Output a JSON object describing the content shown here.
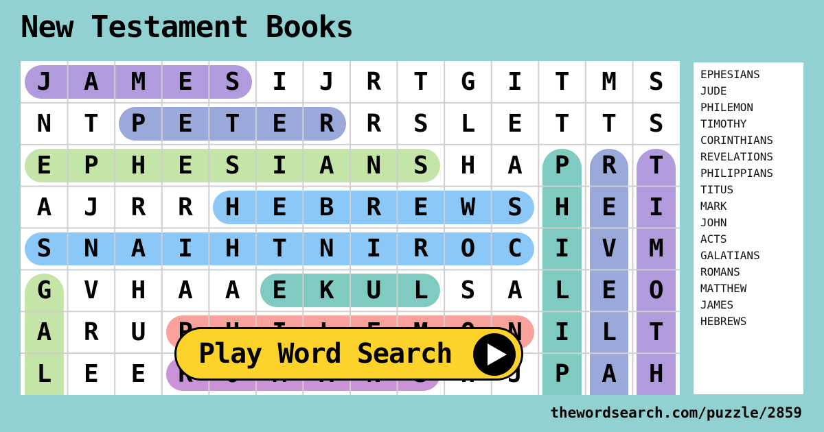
{
  "title": "New Testament Books",
  "grid": {
    "rows": [
      [
        "J",
        "A",
        "M",
        "E",
        "S",
        "I",
        "J",
        "R",
        "T",
        "G",
        "I",
        "T",
        "M",
        "S"
      ],
      [
        "N",
        "T",
        "P",
        "E",
        "T",
        "E",
        "R",
        "R",
        "S",
        "L",
        "E",
        "T",
        "T",
        "S"
      ],
      [
        "E",
        "P",
        "H",
        "E",
        "S",
        "I",
        "A",
        "N",
        "S",
        "H",
        "A",
        "P",
        "R",
        "T"
      ],
      [
        "A",
        "J",
        "R",
        "R",
        "H",
        "E",
        "B",
        "R",
        "E",
        "W",
        "S",
        "H",
        "E",
        "I"
      ],
      [
        "S",
        "N",
        "A",
        "I",
        "H",
        "T",
        "N",
        "I",
        "R",
        "O",
        "C",
        "I",
        "V",
        "M"
      ],
      [
        "G",
        "V",
        "H",
        "A",
        "A",
        "E",
        "K",
        "U",
        "L",
        "S",
        "A",
        "L",
        "E",
        "O"
      ],
      [
        "A",
        "R",
        "U",
        "P",
        "H",
        "I",
        "L",
        "E",
        "M",
        "O",
        "N",
        "I",
        "L",
        "T"
      ],
      [
        "L",
        "E",
        "E",
        "R",
        "O",
        "M",
        "A",
        "N",
        "S",
        "H",
        "J",
        "P",
        "A",
        "H"
      ]
    ],
    "found_words": [
      {
        "word": "JAMES",
        "row": 0,
        "col": 0,
        "dir": "right",
        "length": 5,
        "color": "#9b7fd4"
      },
      {
        "word": "PETER",
        "row": 1,
        "col": 2,
        "dir": "right",
        "length": 5,
        "color": "#7f8fd0"
      },
      {
        "word": "EPHESIANS",
        "row": 2,
        "col": 0,
        "dir": "right",
        "length": 9,
        "color": "#b5dc8f"
      },
      {
        "word": "HEBREWS",
        "row": 3,
        "col": 4,
        "dir": "right",
        "length": 7,
        "color": "#6cb8f5"
      },
      {
        "word": "CORINTHIANS",
        "row": 4,
        "col": 10,
        "dir": "left",
        "length": 11,
        "color": "#6cb8f5"
      },
      {
        "word": "LUKE",
        "row": 5,
        "col": 8,
        "dir": "left",
        "length": 4,
        "color": "#5cbdb0"
      },
      {
        "word": "PHILEMON",
        "row": 6,
        "col": 3,
        "dir": "right",
        "length": 8,
        "color": "#f7867f"
      },
      {
        "word": "ROMANS",
        "row": 7,
        "col": 3,
        "dir": "right",
        "length": 6,
        "color": "#bb74cc"
      },
      {
        "word": "GALATIANS",
        "row": 5,
        "col": 0,
        "dir": "down",
        "length": 3,
        "color": "#b5dc8f"
      },
      {
        "word": "PHILIPPIANS",
        "row": 2,
        "col": 11,
        "dir": "down",
        "length": 6,
        "color": "#5cbdb0"
      },
      {
        "word": "REVELATIONS",
        "row": 2,
        "col": 12,
        "dir": "down",
        "length": 6,
        "color": "#7f8fd0"
      },
      {
        "word": "TIMOTHY",
        "row": 2,
        "col": 13,
        "dir": "down",
        "length": 6,
        "color": "#9b7fd4"
      }
    ]
  },
  "word_list": [
    "EPHESIANS",
    "JUDE",
    "PHILEMON",
    "TIMOTHY",
    "CORINTHIANS",
    "REVELATIONS",
    "PHILIPPIANS",
    "TITUS",
    "MARK",
    "JOHN",
    "ACTS",
    "GALATIANS",
    "ROMANS",
    "MATTHEW",
    "JAMES",
    "HEBREWS"
  ],
  "play_button": {
    "label": "Play Word Search",
    "icon": "play-icon"
  },
  "footer_url": "thewordsearch.com/puzzle/2859",
  "colors": {
    "background": "#92d1d1",
    "button": "#fdd22a"
  }
}
